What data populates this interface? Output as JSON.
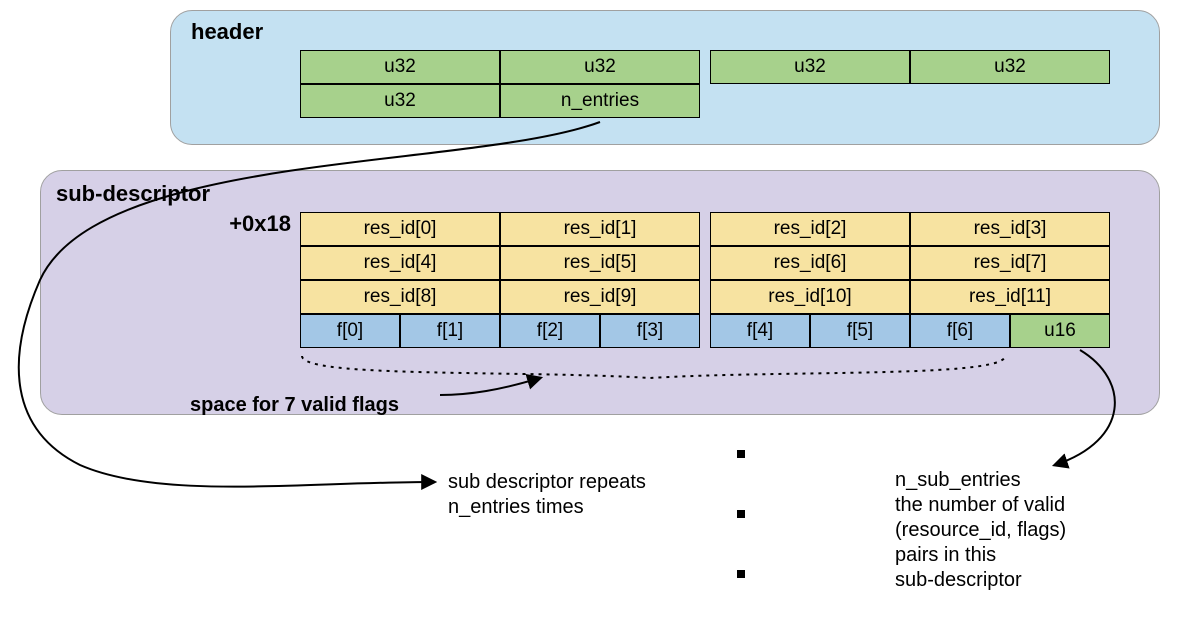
{
  "header": {
    "title": "header",
    "row1": [
      "u32",
      "u32",
      "u32",
      "u32"
    ],
    "row2": [
      "u32",
      "n_entries"
    ]
  },
  "subdesc": {
    "title": "sub-descriptor",
    "offset": "+0x18",
    "row1": [
      "res_id[0]",
      "res_id[1]",
      "res_id[2]",
      "res_id[3]"
    ],
    "row2": [
      "res_id[4]",
      "res_id[5]",
      "res_id[6]",
      "res_id[7]"
    ],
    "row3": [
      "res_id[8]",
      "res_id[9]",
      "res_id[10]",
      "res_id[11]"
    ],
    "row4": [
      "f[0]",
      "f[1]",
      "f[2]",
      "f[3]",
      "f[4]",
      "f[5]",
      "f[6]",
      "u16"
    ]
  },
  "annotations": {
    "flags_caption": "space for 7 valid flags",
    "repeat_line1": "sub descriptor repeats",
    "repeat_line2": "n_entries times",
    "nsub_title": "n_sub_entries",
    "nsub_desc_line1": "the number of valid",
    "nsub_desc_line2": "(resource_id, flags)",
    "nsub_desc_line3": "pairs in this",
    "nsub_desc_line4": "sub-descriptor"
  },
  "colors": {
    "header_panel": "#c4e1f2",
    "subdesc_panel": "#d6d0e7",
    "green": "#a7d18c",
    "yellow": "#f7e3a1",
    "blue": "#a3c7e6"
  }
}
